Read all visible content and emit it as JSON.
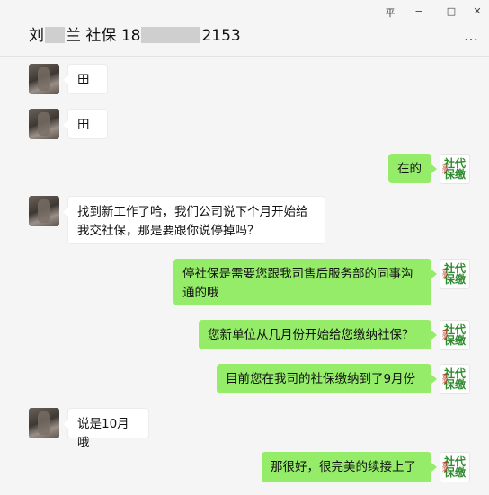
{
  "header": {
    "name_start": "刘",
    "name_end": "兰",
    "label": "社保",
    "phone_start": "18",
    "phone_end": "2153",
    "more_label": "…"
  },
  "window_controls": {
    "pin": "平",
    "minimize": "−",
    "maximize": "□",
    "close": "✕"
  },
  "messages": [
    {
      "side": "left",
      "text": "田"
    },
    {
      "side": "left",
      "text": "田"
    },
    {
      "side": "right",
      "text": "在的"
    },
    {
      "side": "left",
      "line1": "找到新工作了哈，我们公司说下个月开始给",
      "line2": "我交社保，那是要跟你说停掉吗？"
    },
    {
      "side": "right",
      "line1": "停社保是需要您跟我司售后服务部的同事沟",
      "line2": "通的哦"
    },
    {
      "side": "right",
      "text": "您新单位从几月份开始给您缴纳社保？"
    },
    {
      "side": "right",
      "text": "目前您在我司的社保缴纳到了9月份"
    },
    {
      "side": "left",
      "text": "说是10月哦"
    },
    {
      "side": "right",
      "text": "那很好，很完美的续接上了"
    }
  ],
  "brand_avatar": {
    "line1": "社代",
    "line2": "保缴",
    "small": "壹滨"
  },
  "colors": {
    "sent_bubble": "#95ec69",
    "received_bubble": "#ffffff",
    "background": "#f5f5f5"
  }
}
